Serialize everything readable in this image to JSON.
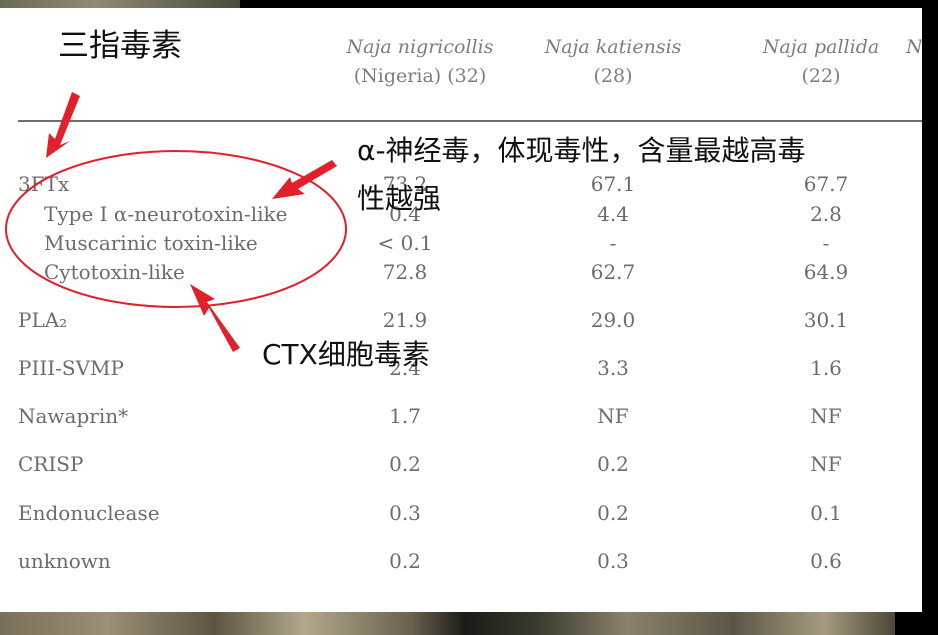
{
  "columns": [
    {
      "species": "Naja nigricollis",
      "sub": "(Nigeria) (32)"
    },
    {
      "species": "Naja katiensis",
      "sub": "(28)"
    },
    {
      "species": "Naja pallida",
      "sub": "(22)"
    },
    {
      "species": "N",
      "sub": ""
    }
  ],
  "rows": [
    {
      "label": "3FTx",
      "sub": false,
      "values": [
        "73.2",
        "67.1",
        "67.7"
      ]
    },
    {
      "label": "Type I α-neurotoxin-like",
      "sub": true,
      "values": [
        "0.4",
        "4.4",
        "2.8"
      ]
    },
    {
      "label": "Muscarinic toxin-like",
      "sub": true,
      "values": [
        "< 0.1",
        "-",
        "-"
      ]
    },
    {
      "label": "Cytotoxin-like",
      "sub": true,
      "values": [
        "72.8",
        "62.7",
        "64.9"
      ]
    },
    {
      "label": "PLA₂",
      "sub": false,
      "values": [
        "21.9",
        "29.0",
        "30.1"
      ]
    },
    {
      "label": "PIII-SVMP",
      "sub": false,
      "values": [
        "2.4",
        "3.3",
        "1.6"
      ]
    },
    {
      "label": "Nawaprin*",
      "sub": false,
      "values": [
        "1.7",
        "NF",
        "NF"
      ]
    },
    {
      "label": "CRISP",
      "sub": false,
      "values": [
        "0.2",
        "0.2",
        "NF"
      ]
    },
    {
      "label": "Endonuclease",
      "sub": false,
      "values": [
        "0.3",
        "0.2",
        "0.1"
      ]
    },
    {
      "label": "unknown",
      "sub": false,
      "values": [
        "0.2",
        "0.3",
        "0.6"
      ]
    }
  ],
  "annotations": {
    "three_finger": "三指毒素",
    "alpha_line1": "α-神经毒，体现毒性，含量最越高毒",
    "alpha_line2": "性越强",
    "ctx": "CTX细胞毒素"
  },
  "colors": {
    "annotation_red": "#e0202a",
    "text_gray": "#6c6c6c"
  }
}
